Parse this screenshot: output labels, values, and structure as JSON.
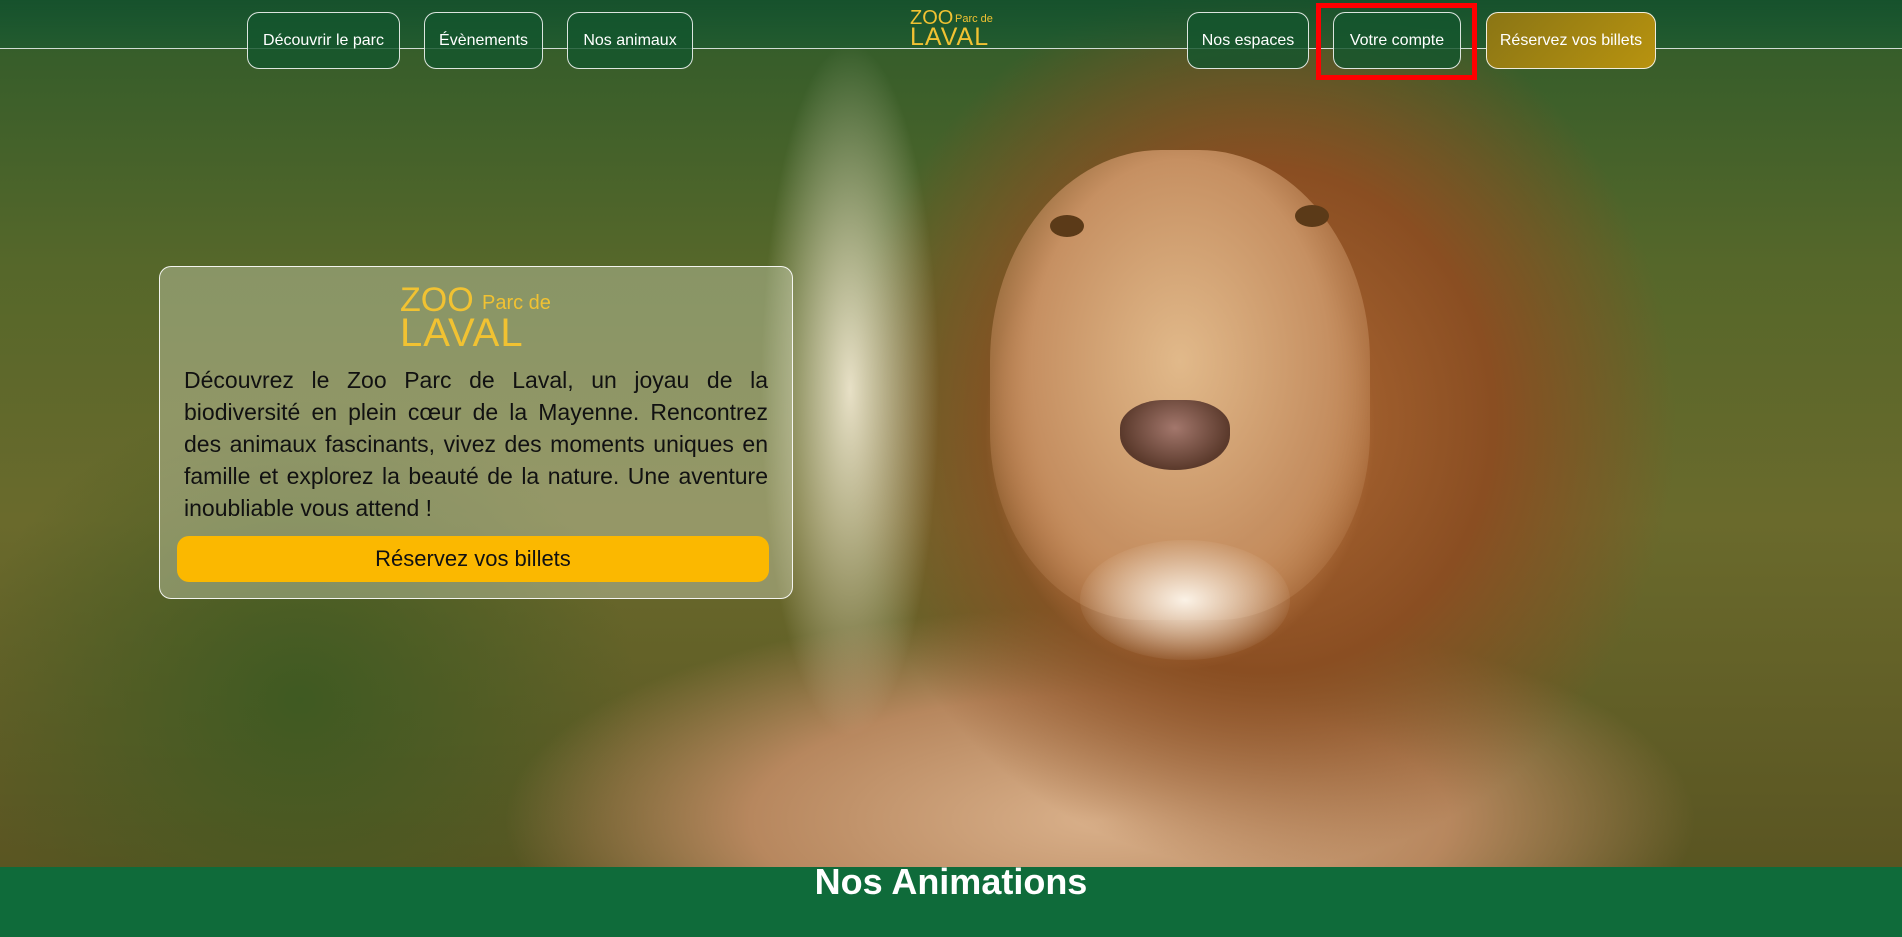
{
  "nav": {
    "discover_label": "Découvrir le parc",
    "events_label": "Évènements",
    "animals_label": "Nos animaux",
    "spaces_label": "Nos espaces",
    "account_label": "Votre compte",
    "tickets_label": "Réservez vos billets"
  },
  "logo": {
    "zoo": "ZOO",
    "parc": "Parc de",
    "laval": "LAVAL"
  },
  "hero": {
    "description": "Découvrez le Zoo Parc de Laval, un joyau de la biodiversité en plein cœur de la Mayenne. Rencontrez des animaux fascinants, vivez des moments uniques en famille et explorez la beauté de la nature. Une aventure inoubliable vous attend !",
    "cta_label": "Réservez vos billets"
  },
  "section": {
    "title": "Nos Animations"
  },
  "colors": {
    "brand_green": "#0f6b3a",
    "logo_gold": "#f1c232",
    "cta_yellow": "#fbb800",
    "highlight": "#ff0000"
  }
}
